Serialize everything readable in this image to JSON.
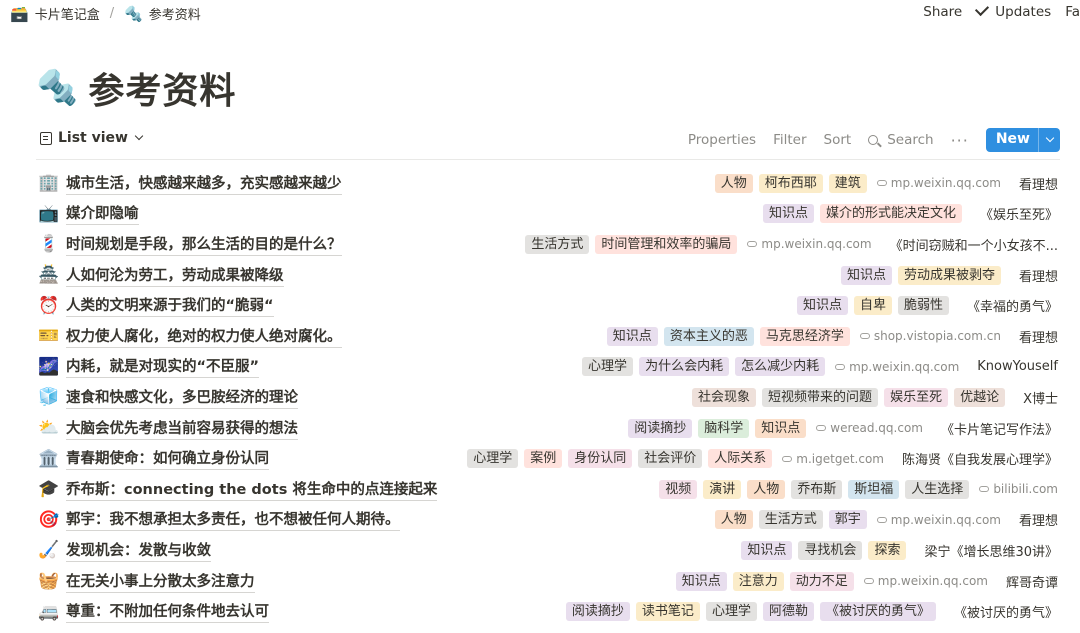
{
  "breadcrumb": [
    {
      "icon": "🗃️",
      "label": "卡片笔记盒"
    },
    {
      "icon": "🔩",
      "label": "参考资料"
    }
  ],
  "top_actions": {
    "share": "Share",
    "updates": "Updates",
    "favorite": "Fa"
  },
  "page": {
    "icon": "🔩",
    "title": "参考资料"
  },
  "view": {
    "label": "List view"
  },
  "toolbar": {
    "properties": "Properties",
    "filter": "Filter",
    "sort": "Sort",
    "search": "Search",
    "more": "···",
    "new": "New"
  },
  "tag_colors": {
    "orange": "#fadec9",
    "yellow": "#fbecc9",
    "purple": "#e8deee",
    "pink": "#f5e0e9",
    "red": "#ffe2dd",
    "gray": "#e3e2e0",
    "blue": "#d3e5ef",
    "green": "#dbeddb",
    "brown": "#eee0da"
  },
  "rows": [
    {
      "icon": "🏢",
      "title": "城市生活，快感越来越多，充实感越来越少",
      "tags": [
        {
          "t": "人物",
          "c": "orange"
        },
        {
          "t": "柯布西耶",
          "c": "yellow"
        },
        {
          "t": "建筑",
          "c": "yellow"
        }
      ],
      "url": "mp.weixin.qq.com",
      "source": "看理想"
    },
    {
      "icon": "📺",
      "title": "媒介即隐喻",
      "tags": [
        {
          "t": "知识点",
          "c": "purple"
        },
        {
          "t": "媒介的形式能决定文化",
          "c": "red"
        }
      ],
      "url": "",
      "source": "《娱乐至死》"
    },
    {
      "icon": "💈",
      "title": "时间规划是手段，那么生活的目的是什么？",
      "tags": [
        {
          "t": "生活方式",
          "c": "gray"
        },
        {
          "t": "时间管理和效率的骗局",
          "c": "red"
        }
      ],
      "url": "mp.weixin.qq.com",
      "source": "《时间窃贼和一个小女孩不..."
    },
    {
      "icon": "🏯",
      "title": "人如何沦为劳工，劳动成果被降级",
      "tags": [
        {
          "t": "知识点",
          "c": "purple"
        },
        {
          "t": "劳动成果被剥夺",
          "c": "yellow"
        }
      ],
      "url": "",
      "source": "看理想"
    },
    {
      "icon": "⏰",
      "title": "人类的文明来源于我们的“脆弱“",
      "tags": [
        {
          "t": "知识点",
          "c": "purple"
        },
        {
          "t": "自卑",
          "c": "yellow"
        },
        {
          "t": "脆弱性",
          "c": "gray"
        }
      ],
      "url": "",
      "source": "《幸福的勇气》"
    },
    {
      "icon": "🎫",
      "title": "权力使人腐化，绝对的权力使人绝对腐化。",
      "tags": [
        {
          "t": "知识点",
          "c": "purple"
        },
        {
          "t": "资本主义的恶",
          "c": "blue"
        },
        {
          "t": "马克思经济学",
          "c": "red"
        }
      ],
      "url": "shop.vistopia.com.cn",
      "source": "看理想"
    },
    {
      "icon": "🌌",
      "title": "内耗，就是对现实的“不臣服”",
      "tags": [
        {
          "t": "心理学",
          "c": "gray"
        },
        {
          "t": "为什么会内耗",
          "c": "purple"
        },
        {
          "t": "怎么减少内耗",
          "c": "purple"
        }
      ],
      "url": "mp.weixin.qq.com",
      "source": "KnowYouself"
    },
    {
      "icon": "🧊",
      "title": "速食和快感文化，多巴胺经济的理论",
      "tags": [
        {
          "t": "社会现象",
          "c": "brown"
        },
        {
          "t": "短视频带来的问题",
          "c": "gray"
        },
        {
          "t": "娱乐至死",
          "c": "pink"
        },
        {
          "t": "优越论",
          "c": "brown"
        }
      ],
      "url": "",
      "source": "X博士"
    },
    {
      "icon": "⛅",
      "title": "大脑会优先考虑当前容易获得的想法",
      "tags": [
        {
          "t": "阅读摘抄",
          "c": "purple"
        },
        {
          "t": "脑科学",
          "c": "green"
        },
        {
          "t": "知识点",
          "c": "orange"
        }
      ],
      "url": "weread.qq.com",
      "source": "《卡片笔记写作法》"
    },
    {
      "icon": "🏛️",
      "title": "青春期使命：如何确立身份认同",
      "tags": [
        {
          "t": "心理学",
          "c": "gray"
        },
        {
          "t": "案例",
          "c": "red"
        },
        {
          "t": "身份认同",
          "c": "pink"
        },
        {
          "t": "社会评价",
          "c": "gray"
        },
        {
          "t": "人际关系",
          "c": "red"
        }
      ],
      "url": "m.igetget.com",
      "source": "陈海贤《自我发展心理学》"
    },
    {
      "icon": "🎓",
      "title": "乔布斯：connecting the dots 将生命中的点连接起来",
      "tags": [
        {
          "t": "视频",
          "c": "pink"
        },
        {
          "t": "演讲",
          "c": "yellow"
        },
        {
          "t": "人物",
          "c": "orange"
        },
        {
          "t": "乔布斯",
          "c": "gray"
        },
        {
          "t": "斯坦福",
          "c": "blue"
        },
        {
          "t": "人生选择",
          "c": "gray"
        }
      ],
      "url": "bilibili.com",
      "source": ""
    },
    {
      "icon": "🎯",
      "title": "郭宇：我不想承担太多责任，也不想被任何人期待。",
      "tags": [
        {
          "t": "人物",
          "c": "orange"
        },
        {
          "t": "生活方式",
          "c": "gray"
        },
        {
          "t": "郭宇",
          "c": "purple"
        }
      ],
      "url": "mp.weixin.qq.com",
      "source": "看理想"
    },
    {
      "icon": "🏑",
      "title": "发现机会：发散与收敛",
      "tags": [
        {
          "t": "知识点",
          "c": "purple"
        },
        {
          "t": "寻找机会",
          "c": "gray"
        },
        {
          "t": "探索",
          "c": "yellow"
        }
      ],
      "url": "",
      "source": "梁宁《增长思维30讲》"
    },
    {
      "icon": "🧺",
      "title": "在无关小事上分散太多注意力",
      "tags": [
        {
          "t": "知识点",
          "c": "purple"
        },
        {
          "t": "注意力",
          "c": "yellow"
        },
        {
          "t": "动力不足",
          "c": "pink"
        }
      ],
      "url": "mp.weixin.qq.com",
      "source": "辉哥奇谭"
    },
    {
      "icon": "🚐",
      "title": "尊重：不附加任何条件地去认可",
      "tags": [
        {
          "t": "阅读摘抄",
          "c": "purple"
        },
        {
          "t": "读书笔记",
          "c": "yellow"
        },
        {
          "t": "心理学",
          "c": "gray"
        },
        {
          "t": "阿德勒",
          "c": "purple"
        },
        {
          "t": "《被讨厌的勇气》",
          "c": "purple"
        }
      ],
      "url": "",
      "source": "《被讨厌的勇气》"
    }
  ]
}
